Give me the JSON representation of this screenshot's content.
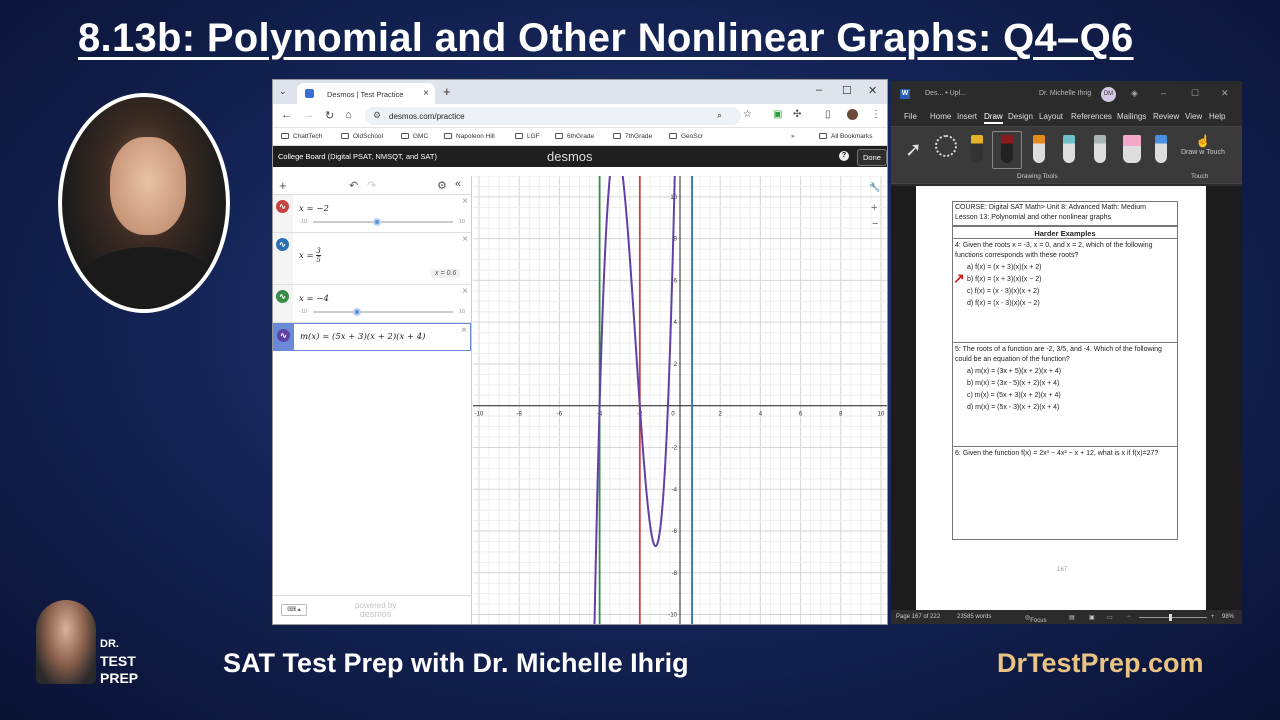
{
  "banner": {
    "title": "8.13b: Polynomial and Other Nonlinear Graphs: Q4–Q6",
    "footer_left": "SAT Test Prep with Dr. Michelle Ihrig",
    "footer_right": "DrTestPrep.com",
    "logo_dr": "DR.",
    "logo_test": "TEST",
    "logo_prep": "PREP"
  },
  "browser": {
    "tab_title": "Desmos | Test Practice",
    "url": "desmos.com/practice",
    "bookmarks": [
      "ChattTech",
      "OldSchool",
      "GMC",
      "Napoleon Hill",
      "LGF",
      "6thGrade",
      "7thGrade",
      "GeoScr"
    ],
    "all_bookmarks": "All Bookmarks"
  },
  "desmos": {
    "header_left": "College Board (Digital PSAT, NMSQT, and SAT)",
    "logo": "desmos",
    "done": "Done",
    "help": "?",
    "expressions": [
      {
        "text": "x = −2",
        "color": "#c74440",
        "slider_min": "-10",
        "slider_max": "10",
        "slider_value": -2
      },
      {
        "text_lhs": "x =",
        "num": "3",
        "den": "5",
        "color": "#2d70b3",
        "value_label": "x = 0.6"
      },
      {
        "text": "x = −4",
        "color": "#388c46",
        "slider_min": "-10",
        "slider_max": "10",
        "slider_value": -4
      },
      {
        "text": "m(x) = (5x + 3)(x + 2)(x + 4)",
        "color": "#6042a6"
      }
    ],
    "powered_by": "powered by",
    "x_ticks": [
      "-10",
      "-8",
      "-6",
      "-4",
      "-2",
      "0",
      "2",
      "4",
      "6",
      "8",
      "10"
    ],
    "y_ticks": [
      "10",
      "8",
      "6",
      "4",
      "2",
      "-2",
      "-4",
      "-6",
      "-8",
      "-10"
    ],
    "graph_range": {
      "xmin": -10.3,
      "xmax": 10.3,
      "ymin": -10.5,
      "ymax": 11.0
    }
  },
  "word": {
    "doc_title": "Des... • Upl...",
    "user": "Dr. Michelle Ihrig",
    "avatar": "DM",
    "menu": [
      "File",
      "Home",
      "Insert",
      "Draw",
      "Design",
      "Layout",
      "References",
      "Mailings",
      "Review",
      "View",
      "Help"
    ],
    "active_menu": "Draw",
    "drawing_tools_label": "Drawing Tools",
    "draw_touch": "Draw w Touch",
    "touch_label": "Touch",
    "header_line1": "COURSE: Digital SAT Math> Unit 8: Advanced Math: Medium",
    "header_line2": "Lesson 13: Polynomial and other nonlinear graphs",
    "section_title": "Harder Examples",
    "q4_stem": "4: Given the roots x = -3, x = 0, and x = 2, which of the following functions corresponds with these roots?",
    "q4_options": [
      "a)  f(x) = (x + 3)(x)(x + 2)",
      "b)  f(x) = (x + 3)(x)(x − 2)",
      "c)  f(x) = (x - 3)(x)(x + 2)",
      "d)  f(x) = (x - 3)(x)(x − 2)"
    ],
    "q5_stem": "5: The roots of a function are -2, 3/5, and -4. Which of the following could be an equation of the function?",
    "q5_options": [
      "a)  m(x) = (3x + 5)(x + 2)(x + 4)",
      "b)  m(x) = (3x - 5)(x + 2)(x + 4)",
      "c)  m(x) = (5x + 3)(x + 2)(x + 4)",
      "d)  m(x) = (5x - 3)(x + 2)(x + 4)"
    ],
    "q6_stem": "6: Given the function f(x) = 2x³ − 4x² − x + 12, what is x if f(x)=27?",
    "page_number": "167",
    "status_page": "Page 167 of 222",
    "status_words": "23585 words",
    "status_focus": "Focus",
    "zoom": "98%"
  }
}
